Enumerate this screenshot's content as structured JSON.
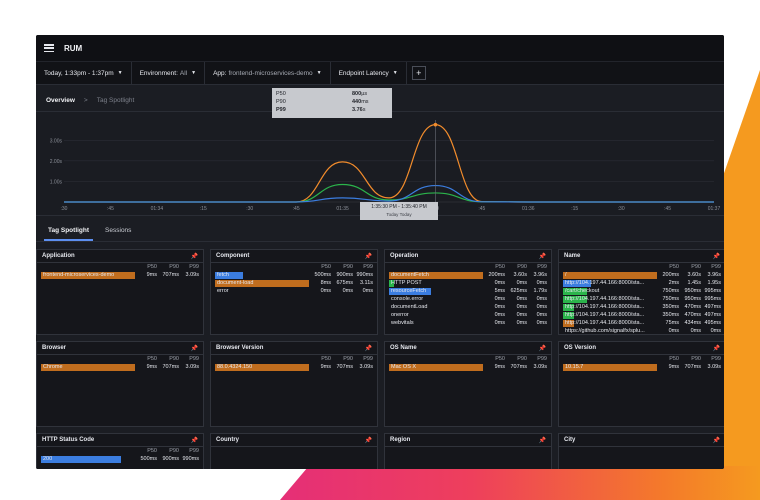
{
  "header": {
    "title": "RUM"
  },
  "filters": {
    "time": "Today, 1:33pm - 1:37pm",
    "environment_label": "Environment:",
    "environment_value": "All",
    "app_label": "App:",
    "app_value": "frontend-microservices-demo",
    "metric": "Endpoint Latency",
    "add": "+"
  },
  "breadcrumb": {
    "current": "Overview",
    "sep": ">",
    "next": "Tag Spotlight"
  },
  "chart_data": {
    "type": "line",
    "x": [
      ":30",
      ":45",
      "01:34",
      ":15",
      ":30",
      ":45",
      "01:35",
      ":15",
      ":30",
      ":45",
      "01:36",
      ":15",
      ":30",
      ":45",
      "01:37"
    ],
    "yticks": [
      "3.00s",
      "2.00s",
      "1.00s"
    ],
    "ylim": [
      0,
      3.5
    ],
    "series": [
      {
        "name": "P99",
        "color": "#f28c2c",
        "values": [
          0,
          0,
          0,
          0,
          0,
          0,
          1.95,
          0.2,
          3.76,
          0.02,
          0,
          0,
          0,
          0,
          0
        ]
      },
      {
        "name": "P90",
        "color": "#2bb44b",
        "values": [
          0,
          0,
          0,
          0,
          0,
          0,
          0.85,
          0.1,
          0.44,
          0.01,
          0,
          0,
          0,
          0,
          0
        ]
      },
      {
        "name": "P50",
        "color": "#3b7de0",
        "values": [
          0,
          0,
          0,
          0,
          0,
          0,
          0.2,
          0.05,
          0.8,
          0.01,
          0,
          0,
          0,
          0,
          0
        ]
      }
    ],
    "tooltip": {
      "rows": [
        {
          "k": "P50",
          "v": "800",
          "u": "µs"
        },
        {
          "k": "P90",
          "v": "440",
          "u": "ms"
        },
        {
          "k": "P99",
          "v": "3.76",
          "u": "s"
        }
      ],
      "time": "1:35:30 PM - 1:35:40 PM",
      "sub": "Today      Today"
    }
  },
  "tabs": [
    "Tag Spotlight",
    "Sessions"
  ],
  "cols": [
    "P50",
    "P90",
    "P99"
  ],
  "panels": [
    {
      "title": "Application",
      "rows": [
        {
          "label": "frontend-microservices-demo",
          "p50": "9ms",
          "p90": "707ms",
          "p99": "3.09s",
          "bars": [
            [
              "#3b7de0",
              0.15
            ],
            [
              "#c06d1e",
              1.0
            ]
          ]
        }
      ]
    },
    {
      "title": "Component",
      "rows": [
        {
          "label": "fetch",
          "p50": "500ms",
          "p90": "900ms",
          "p99": "990ms",
          "bars": [
            [
              "#2bb44b",
              0.2
            ],
            [
              "#3b7de0",
              0.3
            ]
          ]
        },
        {
          "label": "document-load",
          "p50": "8ms",
          "p90": "675ms",
          "p99": "3.11s",
          "bars": [
            [
              "#3b7de0",
              0.1
            ],
            [
              "#c06d1e",
              1.0
            ]
          ]
        },
        {
          "label": "error",
          "p50": "0ms",
          "p90": "0ms",
          "p99": "0ms",
          "bars": []
        }
      ]
    },
    {
      "title": "Operation",
      "rows": [
        {
          "label": "documentFetch",
          "p50": "200ms",
          "p90": "3.60s",
          "p99": "3.96s",
          "bars": [
            [
              "#3b7de0",
              0.85
            ],
            [
              "#c06d1e",
              1.0
            ]
          ]
        },
        {
          "label": "HTTP POST",
          "p50": "0ms",
          "p90": "0ms",
          "p99": "0ms",
          "bars": [
            [
              "#2bb44b",
              0.05
            ]
          ]
        },
        {
          "label": "resourceFetch",
          "p50": "5ms",
          "p90": "625ms",
          "p99": "1.79s",
          "bars": [
            [
              "#3b7de0",
              0.45
            ]
          ]
        },
        {
          "label": "console.error",
          "p50": "0ms",
          "p90": "0ms",
          "p99": "0ms",
          "bars": []
        },
        {
          "label": "documentLoad",
          "p50": "0ms",
          "p90": "0ms",
          "p99": "0ms",
          "bars": []
        },
        {
          "label": "onerror",
          "p50": "0ms",
          "p90": "0ms",
          "p99": "0ms",
          "bars": []
        },
        {
          "label": "webvitals",
          "p50": "0ms",
          "p90": "0ms",
          "p99": "0ms",
          "bars": []
        }
      ]
    },
    {
      "title": "Name",
      "rows": [
        {
          "label": "/",
          "p50": "200ms",
          "p90": "3.60s",
          "p99": "3.96s",
          "bars": [
            [
              "#2bb44b",
              0.05
            ],
            [
              "#3b7de0",
              0.9
            ],
            [
              "#c06d1e",
              1.0
            ]
          ]
        },
        {
          "label": "http://104.197.44.166:8000/sta...",
          "p50": "2ms",
          "p90": "1.45s",
          "p99": "1.95s",
          "bars": [
            [
              "#3b7de0",
              0.3
            ]
          ]
        },
        {
          "label": "/cart/checkout",
          "p50": "750ms",
          "p90": "950ms",
          "p99": "995ms",
          "bars": [
            [
              "#2bb44b",
              0.25
            ]
          ]
        },
        {
          "label": "http://104.197.44.166:8000/sta...",
          "p50": "750ms",
          "p90": "950ms",
          "p99": "995ms",
          "bars": [
            [
              "#2bb44b",
              0.25
            ]
          ]
        },
        {
          "label": "http://104.197.44.166:8000/sta...",
          "p50": "350ms",
          "p90": "470ms",
          "p99": "497ms",
          "bars": [
            [
              "#2bb44b",
              0.12
            ]
          ]
        },
        {
          "label": "http://104.197.44.166:8000/sta...",
          "p50": "350ms",
          "p90": "470ms",
          "p99": "497ms",
          "bars": [
            [
              "#2bb44b",
              0.12
            ]
          ]
        },
        {
          "label": "http://104.197.44.166:8000/sta...",
          "p50": "75ms",
          "p90": "434ms",
          "p99": "495ms",
          "bars": [
            [
              "#c06d1e",
              0.12
            ]
          ]
        },
        {
          "label": "https://github.com/signalfx/splu...",
          "p50": "0ms",
          "p90": "0ms",
          "p99": "0ms",
          "bars": []
        }
      ]
    },
    {
      "title": "Browser",
      "rows": [
        {
          "label": "Chrome",
          "p50": "9ms",
          "p90": "707ms",
          "p99": "3.09s",
          "bars": [
            [
              "#3b7de0",
              0.15
            ],
            [
              "#c06d1e",
              1.0
            ]
          ]
        }
      ]
    },
    {
      "title": "Browser Version",
      "rows": [
        {
          "label": "88.0.4324.150",
          "p50": "9ms",
          "p90": "707ms",
          "p99": "3.09s",
          "bars": [
            [
              "#3b7de0",
              0.15
            ],
            [
              "#c06d1e",
              1.0
            ]
          ]
        }
      ]
    },
    {
      "title": "OS Name",
      "rows": [
        {
          "label": "Mac OS X",
          "p50": "9ms",
          "p90": "707ms",
          "p99": "3.09s",
          "bars": [
            [
              "#3b7de0",
              0.15
            ],
            [
              "#c06d1e",
              1.0
            ]
          ]
        }
      ]
    },
    {
      "title": "OS Version",
      "rows": [
        {
          "label": "10.15.7",
          "p50": "9ms",
          "p90": "707ms",
          "p99": "3.09s",
          "bars": [
            [
              "#3b7de0",
              0.15
            ],
            [
              "#c06d1e",
              1.0
            ]
          ]
        }
      ]
    },
    {
      "title": "HTTP Status Code",
      "rows": [
        {
          "label": "200",
          "p50": "500ms",
          "p90": "900ms",
          "p99": "990ms",
          "bars": [
            [
              "#2bb44b",
              0.45
            ],
            [
              "#3b7de0",
              0.85
            ]
          ]
        }
      ]
    },
    {
      "title": "Country",
      "rows": []
    },
    {
      "title": "Region",
      "rows": []
    },
    {
      "title": "City",
      "rows": []
    }
  ]
}
